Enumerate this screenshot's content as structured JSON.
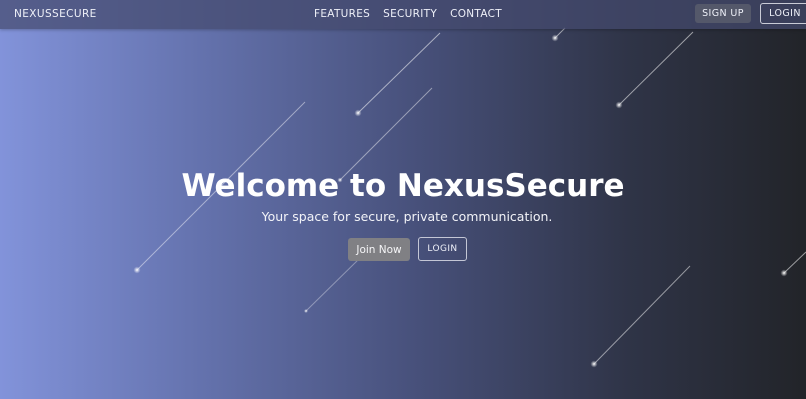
{
  "navbar": {
    "brand": "NEXUSSECURE",
    "links": [
      {
        "label": "FEATURES"
      },
      {
        "label": "SECURITY"
      },
      {
        "label": "CONTACT"
      }
    ],
    "signup_label": "SIGN UP",
    "login_label": "LOGIN"
  },
  "hero": {
    "title": "Welcome to NexusSecure",
    "subtitle": "Your space for secure, private communication.",
    "join_label": "Join Now",
    "login_label": "LOGIN"
  },
  "colors": {
    "gradient_start": "#8293da",
    "gradient_end": "#222429",
    "navbar_bg": "#444a6e",
    "signup_bg": "#54586a",
    "join_bg": "#808084"
  }
}
